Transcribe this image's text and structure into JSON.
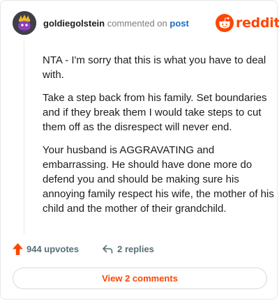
{
  "comment": {
    "username": "goldiegolstein",
    "action_text": "commented on",
    "post_link": "post",
    "paragraphs": [
      "NTA - I'm sorry that this is what you have to deal with.",
      "Take a step back from his family. Set boundaries and if they break them I would take steps to cut them off as the disrespect will never end.",
      "Your husband is AGGRAVATING and embarrassing. He should have done more do defend you and should be making sure his annoying family respect his wife, the mother of his child and the mother of their grandchild."
    ],
    "upvotes": "944 upvotes",
    "replies": "2 replies",
    "view_comments": "View 2 comments"
  },
  "brand": {
    "wordmark": "reddit",
    "color": "#ff4500"
  },
  "icons": {
    "avatar": "snoo-avatar",
    "logo": "reddit-snoo-icon",
    "upvote": "upvote-arrow-icon",
    "reply": "reply-arrow-icon"
  }
}
